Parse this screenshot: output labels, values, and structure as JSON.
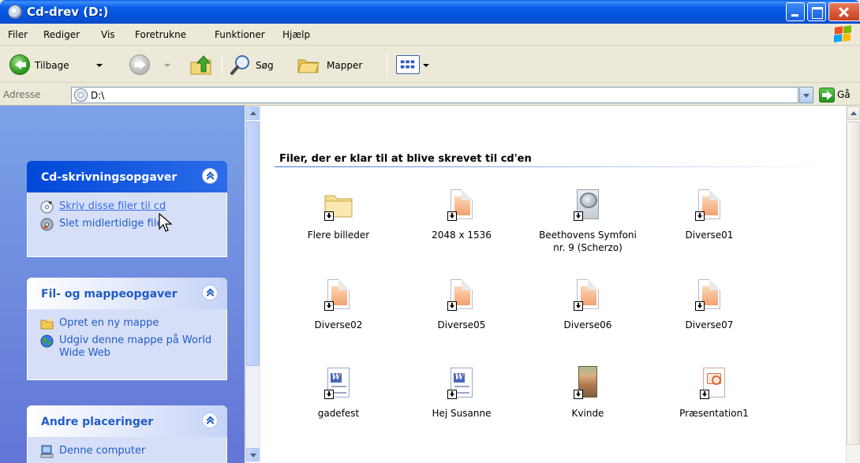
{
  "window": {
    "title": "Cd-drev (D:)"
  },
  "menu": [
    "Filer",
    "Rediger",
    "Vis",
    "Foretrukne",
    "Funktioner",
    "Hjælp"
  ],
  "toolbar": {
    "back_label": "Tilbage",
    "search_label": "Søg",
    "folders_label": "Mapper"
  },
  "address": {
    "label": "Adresse",
    "value": "D:\\",
    "go_label": "Gå"
  },
  "panels": [
    {
      "title": "Cd-skrivningsopgaver",
      "tasks": [
        {
          "label": "Skriv disse filer til cd",
          "icon": "cd-burn-icon"
        },
        {
          "label": "Slet midlertidige filer",
          "icon": "delete-temp-icon"
        }
      ]
    },
    {
      "title": "Fil- og mappeopgaver",
      "tasks": [
        {
          "label": "Opret en ny mappe",
          "icon": "new-folder-icon"
        },
        {
          "label": "Udgiv denne mappe på World Wide Web",
          "icon": "web-publish-icon"
        }
      ]
    },
    {
      "title": "Andre placeringer",
      "tasks": [
        {
          "label": "Denne computer",
          "icon": "computer-icon"
        }
      ]
    }
  ],
  "content": {
    "group_title": "Filer, der er klar til at blive skrevet til cd'en",
    "files": [
      {
        "name": "Flere billeder",
        "type": "folder"
      },
      {
        "name": "2048 x 1536",
        "type": "image"
      },
      {
        "name": "Beethovens Symfoni nr. 9 (Scherzo)",
        "type": "media"
      },
      {
        "name": "Diverse01",
        "type": "image"
      },
      {
        "name": "Diverse02",
        "type": "image"
      },
      {
        "name": "Diverse05",
        "type": "image"
      },
      {
        "name": "Diverse06",
        "type": "image"
      },
      {
        "name": "Diverse07",
        "type": "image"
      },
      {
        "name": "gadefest",
        "type": "word"
      },
      {
        "name": "Hej Susanne",
        "type": "word"
      },
      {
        "name": "Kvinde",
        "type": "photo"
      },
      {
        "name": "Præsentation1",
        "type": "powerpoint"
      }
    ]
  },
  "colors": {
    "titlebar": "#0553da",
    "taskpane_bg": "#7ba2e7",
    "task_link": "#215dc6"
  }
}
